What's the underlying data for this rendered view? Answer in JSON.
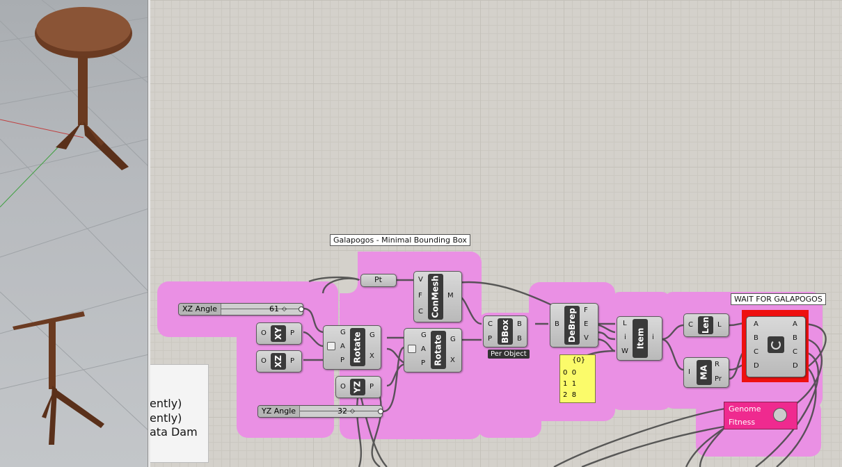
{
  "group_labels": {
    "main": "Galapogos - Minimal Bounding Box",
    "wait": "WAIT FOR GALAPOGOS"
  },
  "sliders": [
    {
      "label": "XZ Angle",
      "value": "61"
    },
    {
      "label": "YZ Angle",
      "value": "32"
    }
  ],
  "components": {
    "xy": {
      "name": "XY",
      "inputs": [
        "O"
      ],
      "outputs": [
        "P"
      ]
    },
    "xz": {
      "name": "XZ",
      "inputs": [
        "O"
      ],
      "outputs": [
        "P"
      ]
    },
    "yz": {
      "name": "YZ",
      "inputs": [
        "O"
      ],
      "outputs": [
        "P"
      ]
    },
    "rotate1": {
      "name": "Rotate",
      "inputs": [
        "G",
        "A",
        "P"
      ],
      "outputs": [
        "G",
        "X"
      ]
    },
    "rotate2": {
      "name": "Rotate",
      "inputs": [
        "G",
        "A",
        "P"
      ],
      "outputs": [
        "G",
        "X"
      ]
    },
    "pt": {
      "name": "Pt"
    },
    "conmesh": {
      "name": "ConMesh",
      "inputs": [
        "V",
        "F",
        "C"
      ],
      "outputs": [
        "M"
      ]
    },
    "bbox": {
      "name": "BBox",
      "inputs": [
        "C",
        "P"
      ],
      "outputs": [
        "B",
        "B"
      ],
      "tag": "Per Object"
    },
    "debrep": {
      "name": "DeBrep",
      "inputs": [
        "B"
      ],
      "outputs": [
        "F",
        "E",
        "V"
      ]
    },
    "item": {
      "name": "Item",
      "inputs": [
        "L",
        "i",
        "W"
      ],
      "outputs": [
        "i"
      ]
    },
    "len": {
      "name": "Len",
      "inputs": [
        "C"
      ],
      "outputs": [
        "L"
      ]
    },
    "ma": {
      "name": "MA",
      "inputs": [
        "I"
      ],
      "outputs": [
        "R",
        "Pr"
      ]
    },
    "merge": {
      "inputs": [
        "A",
        "B",
        "C",
        "D"
      ],
      "outputs": [
        "A",
        "B",
        "C",
        "D"
      ]
    }
  },
  "panel": {
    "header": "{0}",
    "rows": [
      {
        "index": "0",
        "value": "0"
      },
      {
        "index": "1",
        "value": "1"
      },
      {
        "index": "2",
        "value": "8"
      }
    ]
  },
  "galapagos": {
    "genome": "Genome",
    "fitness": "Fitness"
  },
  "paper_lines": [
    "ently)",
    "ently)",
    "ata Dam"
  ],
  "colors": {
    "group": "#ea90e4",
    "wait": "#ee1010",
    "galapagos": "#ef2a8f",
    "panel": "#fbfb6a"
  }
}
